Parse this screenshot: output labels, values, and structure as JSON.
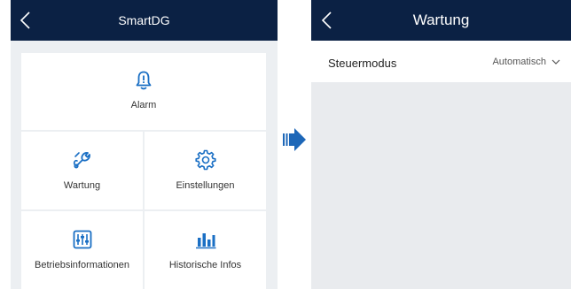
{
  "left_screen": {
    "title": "SmartDG",
    "tiles": {
      "alarm": "Alarm",
      "wartung": "Wartung",
      "einstellungen": "Einstellungen",
      "betriebsinfo": "Betriebsinformationen",
      "historisch": "Historische Infos"
    },
    "icons": {
      "alarm": "bell-alert-icon",
      "wartung": "wrench-icon",
      "einstellungen": "gear-icon",
      "betriebsinfo": "sliders-icon",
      "historisch": "bar-chart-icon"
    }
  },
  "right_screen": {
    "title": "Wartung",
    "control_mode": {
      "label": "Steuermodus",
      "value": "Automatisch"
    }
  },
  "colors": {
    "header_bg": "#0b2144",
    "icon_blue": "#1a6fc4",
    "arrow_blue": "#1d67b8",
    "panel_bg": "#eceff2"
  }
}
